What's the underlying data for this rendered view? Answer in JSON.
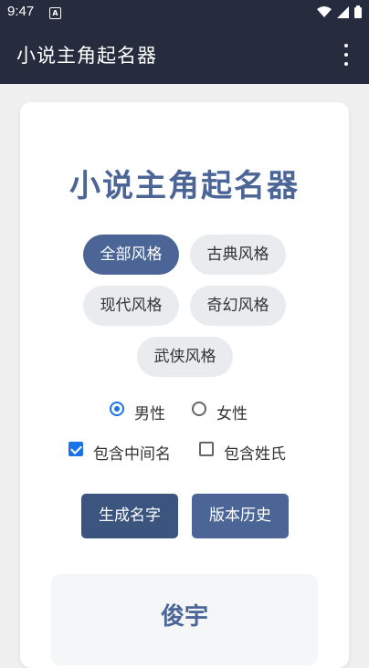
{
  "statusbar": {
    "time": "9:47",
    "notification": "A"
  },
  "appbar": {
    "title": "小说主角起名器",
    "menu_icon": "more-vert-icon"
  },
  "headline": "小说主角起名器",
  "styles": [
    {
      "label": "全部风格",
      "selected": true
    },
    {
      "label": "古典风格",
      "selected": false
    },
    {
      "label": "现代风格",
      "selected": false
    },
    {
      "label": "奇幻风格",
      "selected": false
    },
    {
      "label": "武侠风格",
      "selected": false
    }
  ],
  "gender": {
    "options": [
      "男性",
      "女性"
    ],
    "selected": "男性"
  },
  "options": [
    {
      "label": "包含中间名",
      "checked": true
    },
    {
      "label": "包含姓氏",
      "checked": false
    }
  ],
  "buttons": {
    "generate": "生成名字",
    "history": "版本历史"
  },
  "result": {
    "name": "俊宇"
  },
  "colors": {
    "primary": "#4a6596",
    "dark_primary": "#3b557f",
    "appbar": "#262b3d",
    "accent": "#1a73e8"
  }
}
